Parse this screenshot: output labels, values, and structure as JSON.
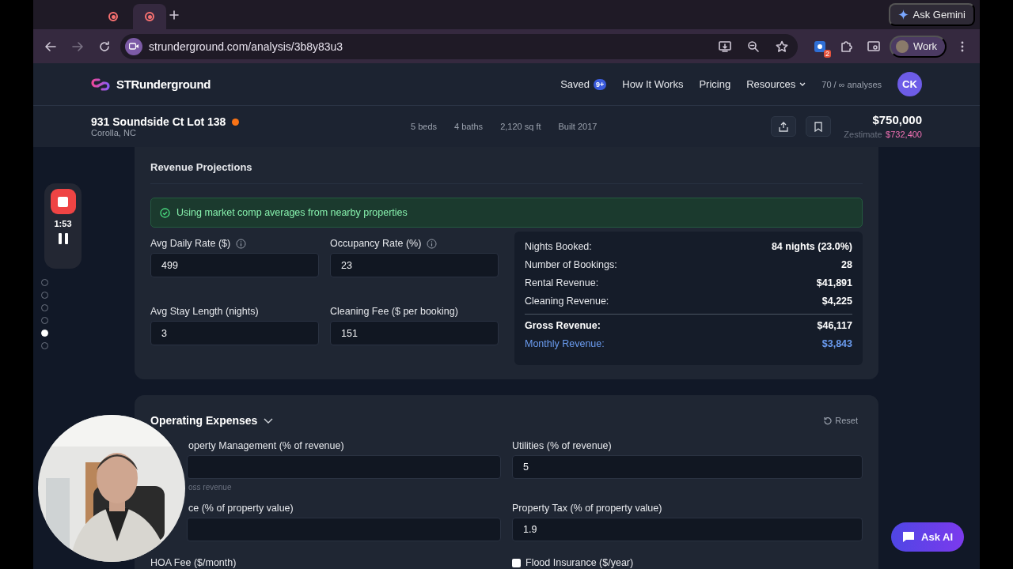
{
  "browser": {
    "tabs": [
      {
        "selected": false
      },
      {
        "selected": true
      }
    ],
    "ask_gemini": "Ask Gemini",
    "url": "strunderground.com/analysis/3b8y83u3",
    "extension_badge": "2",
    "profile": "Work"
  },
  "site": {
    "brand": "STRunderground",
    "nav": [
      {
        "label": "Saved",
        "badge": "9+",
        "dropdown": false
      },
      {
        "label": "How It Works",
        "dropdown": false
      },
      {
        "label": "Pricing",
        "dropdown": false
      },
      {
        "label": "Resources",
        "dropdown": true
      }
    ],
    "usage": "70 / ∞ analyses",
    "avatar": "CK"
  },
  "property": {
    "address": "931 Soundside Ct Lot 138",
    "city": "Corolla, NC",
    "facts": [
      "5 beds",
      "4 baths",
      "2,120 sq ft",
      "Built 2017"
    ],
    "price": "$750,000",
    "zestimate_label": "Zestimate",
    "zestimate": "$732,400"
  },
  "recorder": {
    "time": "1:53",
    "steps": [
      {
        "selected": false
      },
      {
        "selected": false
      },
      {
        "selected": false
      },
      {
        "selected": false
      },
      {
        "selected": true
      },
      {
        "selected": false
      }
    ]
  },
  "revenue": {
    "title": "Revenue Projections",
    "notice": "Using market comp averages from nearby properties",
    "fields": [
      {
        "label": "Avg Daily Rate ($)",
        "value": "499",
        "info": true
      },
      {
        "label": "Occupancy Rate (%)",
        "value": "23",
        "info": true
      },
      {
        "label": "Avg Stay Length (nights)",
        "value": "3",
        "info": false
      },
      {
        "label": "Cleaning Fee ($ per booking)",
        "value": "151",
        "info": false
      }
    ],
    "summary": [
      {
        "label": "Nights Booked:",
        "value": "84 nights (23.0%)",
        "kind": "normal"
      },
      {
        "label": "Number of Bookings:",
        "value": "28",
        "kind": "normal"
      },
      {
        "label": "Rental Revenue:",
        "value": "$41,891",
        "kind": "normal"
      },
      {
        "label": "Cleaning Revenue:",
        "value": "$4,225",
        "kind": "normal"
      },
      {
        "label": "Gross Revenue:",
        "value": "$46,117",
        "kind": "total"
      },
      {
        "label": "Monthly Revenue:",
        "value": "$3,843",
        "kind": "monthly"
      }
    ]
  },
  "expenses": {
    "title": "Operating Expenses",
    "reset": "Reset",
    "fields": [
      {
        "kind": "input",
        "label": "operty Management (% of revenue)",
        "hint": "oss revenue"
      },
      {
        "kind": "input",
        "label": "Utilities (% of revenue)",
        "value": "5"
      },
      {
        "kind": "input",
        "label": "ce (% of property value)"
      },
      {
        "kind": "input",
        "label": "Property Tax (% of property value)",
        "value": "1.9"
      },
      {
        "kind": "label",
        "label": "HOA Fee ($/month)"
      },
      {
        "kind": "checkbox",
        "label": "Flood Insurance ($/year)",
        "checked": false
      }
    ]
  },
  "ask_ai": "Ask AI"
}
